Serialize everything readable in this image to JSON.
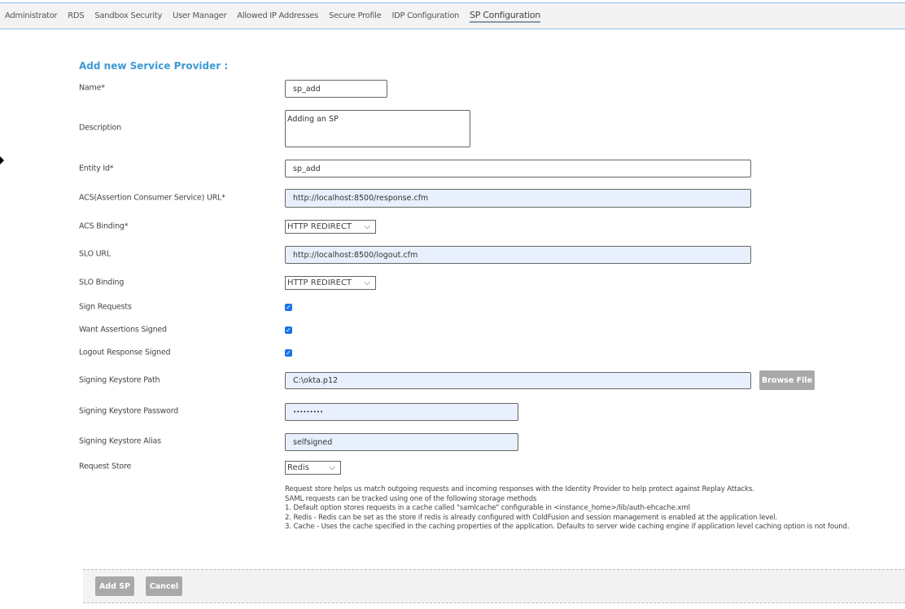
{
  "nav": {
    "tabs": [
      "Administrator",
      "RDS",
      "Sandbox Security",
      "User Manager",
      "Allowed IP Addresses",
      "Secure Profile",
      "IDP Configuration",
      "SP Configuration"
    ],
    "active": "SP Configuration"
  },
  "form": {
    "title": "Add new Service Provider :",
    "name": {
      "label": "Name*",
      "value": "sp_add"
    },
    "description": {
      "label": "Description",
      "value": "Adding an SP"
    },
    "entity_id": {
      "label": "Entity Id*",
      "value": "sp_add"
    },
    "acs_url": {
      "label": "ACS(Assertion Consumer Service) URL*",
      "value": "http://localhost:8500/response.cfm"
    },
    "acs_binding": {
      "label": "ACS Binding*",
      "value": "HTTP REDIRECT"
    },
    "slo_url": {
      "label": "SLO URL",
      "value": "http://localhost:8500/logout.cfm"
    },
    "slo_binding": {
      "label": "SLO Binding",
      "value": "HTTP REDIRECT"
    },
    "sign_requests": {
      "label": "Sign Requests",
      "checked": true
    },
    "want_assertions_signed": {
      "label": "Want Assertions Signed",
      "checked": true
    },
    "logout_response_signed": {
      "label": "Logout Response Signed",
      "checked": true
    },
    "keystore_path": {
      "label": "Signing Keystore Path",
      "value": "C:\\okta.p12",
      "browse_label": "Browse File"
    },
    "keystore_password": {
      "label": "Signing Keystore Password",
      "value": "•••••••••"
    },
    "keystore_alias": {
      "label": "Signing Keystore Alias",
      "value": "selfsigned"
    },
    "request_store": {
      "label": "Request Store",
      "value": "Redis"
    },
    "help": [
      "Request store helps us match outgoing requests and incoming responses with the Identity Provider to help protect against Replay Attacks.",
      "SAML requests can be tracked using one of the following storage methods",
      "1. Default option stores requests in a cache called \"samlcache\" configurable in <instance_home>/lib/auth-ehcache.xml",
      "2. Redis - Redis can be set as the store if redis is already configured with ColdFusion and session management is enabled at the application level.",
      "3. Cache - Uses the cache specified in the caching properties of the application. Defaults to server wide caching engine if application level caching option is not found."
    ]
  },
  "footer": {
    "add_label": "Add SP",
    "cancel_label": "Cancel"
  },
  "colors": {
    "title": "#3c9ad4",
    "button": "#a9a9a9",
    "autofill": "#e8f0fe"
  }
}
